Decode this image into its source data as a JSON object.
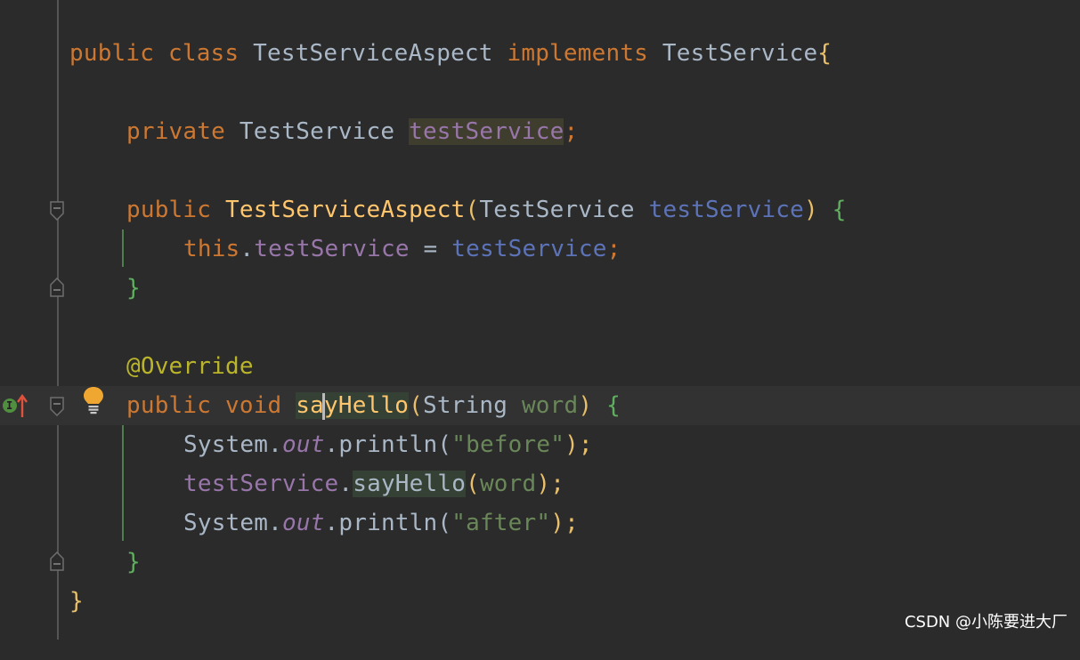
{
  "editor": {
    "lines": [
      {
        "t1": "public",
        "t2": "class",
        "t3": "TestServiceAspect",
        "t4": "implements",
        "t5": "TestService",
        "t6": "{"
      },
      {
        "t1": "private",
        "t2": "TestService",
        "t3": "testService",
        "t4": ";"
      },
      {
        "t1": "public",
        "t2": "TestServiceAspect",
        "t3": "(",
        "t4": "TestService",
        "t5": "testService",
        "t6": ")",
        "t7": "{"
      },
      {
        "t1": "this",
        "t2": ".",
        "t3": "testService",
        "t4": " = ",
        "t5": "testService",
        "t6": ";"
      },
      {
        "t1": "}"
      },
      {
        "t1": "@Override"
      },
      {
        "t1": "public",
        "t2": "void",
        "t3a": "sa",
        "t3b": "yHello",
        "t4": "(",
        "t5": "String",
        "t6": "word",
        "t7": ")",
        "t8": "{"
      },
      {
        "t1": "System.",
        "t2": "out",
        "t3": ".println(",
        "t4": "\"before\"",
        "t5": ");"
      },
      {
        "t1": "testService",
        "t2": ".",
        "t3": "sayHello",
        "t4": "(",
        "t5": "word",
        "t6": ");"
      },
      {
        "t1": "System.",
        "t2": "out",
        "t3": ".println(",
        "t4": "\"after\"",
        "t5": ");"
      },
      {
        "t1": "}"
      },
      {
        "t1": "}"
      }
    ]
  },
  "gutter": {
    "implements_marker": "I"
  },
  "watermark": "CSDN @小陈要进大厂"
}
